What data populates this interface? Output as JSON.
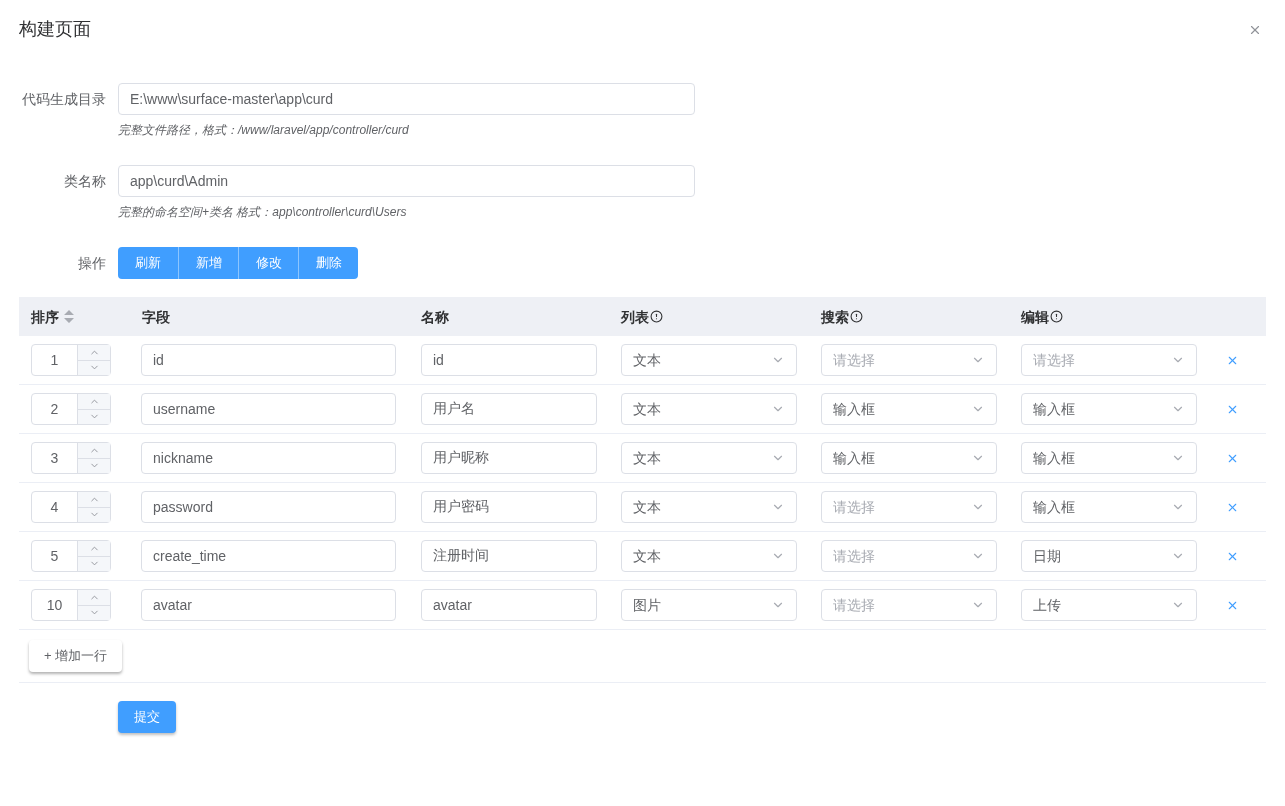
{
  "dialog": {
    "title": "构建页面"
  },
  "form": {
    "fields": [
      {
        "label": "代码生成目录",
        "value": "E:\\www\\surface-master\\app\\curd",
        "help": "完整文件路径，格式：/www/laravel/app/controller/curd"
      },
      {
        "label": "类名称",
        "value": "app\\curd\\Admin",
        "help": "完整的命名空间+类名 格式：app\\controller\\curd\\Users"
      }
    ],
    "actions": {
      "label": "操作",
      "buttons": [
        "刷新",
        "新增",
        "修改",
        "删除"
      ]
    }
  },
  "table": {
    "columns": [
      {
        "label": "排序",
        "kind": "sortable"
      },
      {
        "label": "字段",
        "kind": "plain"
      },
      {
        "label": "名称",
        "kind": "plain"
      },
      {
        "label": "列表",
        "kind": "info"
      },
      {
        "label": "搜索",
        "kind": "info"
      },
      {
        "label": "编辑",
        "kind": "info"
      }
    ],
    "rows": [
      {
        "order": "1",
        "field": "id",
        "name": "id",
        "list": {
          "value": "文本"
        },
        "search": {
          "placeholder": "请选择"
        },
        "edit": {
          "placeholder": "请选择"
        }
      },
      {
        "order": "2",
        "field": "username",
        "name": "用户名",
        "list": {
          "value": "文本"
        },
        "search": {
          "value": "输入框"
        },
        "edit": {
          "value": "输入框"
        }
      },
      {
        "order": "3",
        "field": "nickname",
        "name": "用户昵称",
        "list": {
          "value": "文本"
        },
        "search": {
          "value": "输入框"
        },
        "edit": {
          "value": "输入框"
        }
      },
      {
        "order": "4",
        "field": "password",
        "name": "用户密码",
        "list": {
          "value": "文本"
        },
        "search": {
          "placeholder": "请选择"
        },
        "edit": {
          "value": "输入框"
        }
      },
      {
        "order": "5",
        "field": "create_time",
        "name": "注册时间",
        "list": {
          "value": "文本"
        },
        "search": {
          "placeholder": "请选择"
        },
        "edit": {
          "value": "日期"
        }
      },
      {
        "order": "10",
        "field": "avatar",
        "name": "avatar",
        "list": {
          "value": "图片"
        },
        "search": {
          "placeholder": "请选择"
        },
        "edit": {
          "value": "上传"
        }
      }
    ]
  },
  "add_row_button": "+ 增加一行",
  "submit_button": "提交"
}
